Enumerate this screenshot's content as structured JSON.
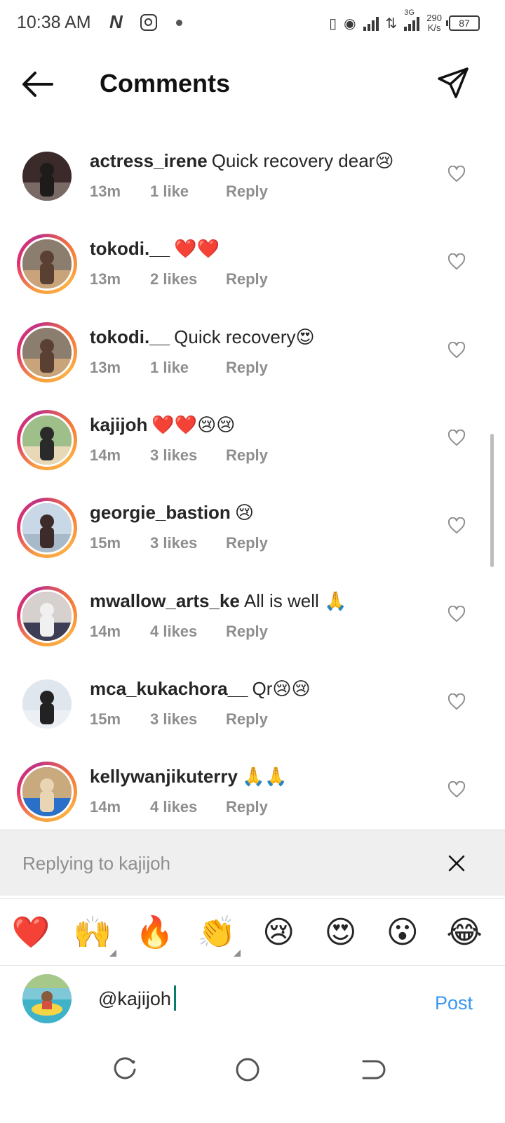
{
  "status_bar": {
    "time": "10:38 AM",
    "network_type": "3G",
    "net_speed_top": "290",
    "net_speed_bottom": "K/s",
    "battery": "87"
  },
  "header": {
    "title": "Comments",
    "back_icon": "arrow-left-icon",
    "send_icon": "paper-plane-icon"
  },
  "comments": [
    {
      "username": "actress_irene",
      "text": "Quick recovery dear😢",
      "time": "13m",
      "likes": "1 like",
      "reply": "Reply",
      "story_ring": false
    },
    {
      "username": "tokodi.__",
      "text": "❤️❤️",
      "time": "13m",
      "likes": "2 likes",
      "reply": "Reply",
      "story_ring": true
    },
    {
      "username": "tokodi.__",
      "text": "Quick recovery😍",
      "time": "13m",
      "likes": "1 like",
      "reply": "Reply",
      "story_ring": true
    },
    {
      "username": "kajijoh",
      "text": "❤️❤️😢😢",
      "time": "14m",
      "likes": "3 likes",
      "reply": "Reply",
      "story_ring": true
    },
    {
      "username": "georgie_bastion",
      "text": "😢",
      "time": "15m",
      "likes": "3 likes",
      "reply": "Reply",
      "story_ring": true
    },
    {
      "username": "mwallow_arts_ke",
      "text": "All is well 🙏",
      "time": "14m",
      "likes": "4 likes",
      "reply": "Reply",
      "story_ring": true
    },
    {
      "username": "mca_kukachora__",
      "text": "Qr😢😢",
      "time": "15m",
      "likes": "3 likes",
      "reply": "Reply",
      "story_ring": false
    },
    {
      "username": "kellywanjikuterry",
      "text": "🙏🙏",
      "time": "14m",
      "likes": "4 likes",
      "reply": "Reply",
      "story_ring": true
    }
  ],
  "reply_bar": {
    "text": "Replying to kajijoh"
  },
  "emoji_bar": [
    "❤️",
    "🙌",
    "🔥",
    "👏",
    "😢",
    "😍",
    "😮",
    "😂"
  ],
  "composer": {
    "value": "@kajijoh",
    "post_label": "Post"
  },
  "colors": {
    "accent": "#3897f0",
    "meta_gray": "#8e8e8e",
    "reply_bar_bg": "#efefef"
  }
}
